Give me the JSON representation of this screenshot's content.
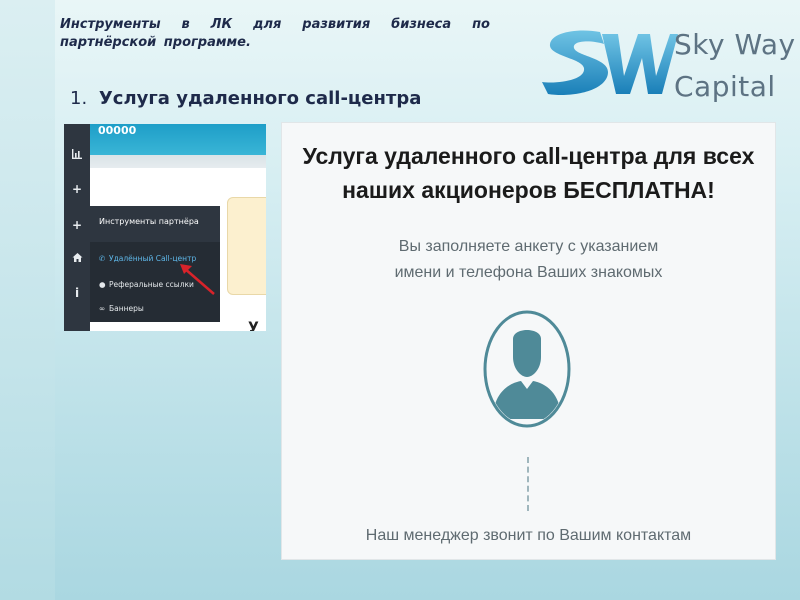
{
  "header": {
    "title": "Инструменты в ЛК для развития бизнеса по партнёрской программе."
  },
  "logo": {
    "mark": "SW",
    "line1": "Sky Way",
    "line2": "Capital"
  },
  "section": {
    "number": "1.",
    "title": "Услуга удаленного call-центра"
  },
  "screenshot_left": {
    "topbar_value": "00000",
    "sidebar_icons": [
      "bar-chart-icon",
      "plus-icon",
      "plus-icon",
      "home-icon",
      "info-icon"
    ],
    "menu_title": "Инструменты партнёра",
    "menu_items": [
      {
        "label": "Удалённый Call-центр",
        "icon": "phone-icon",
        "active": true
      },
      {
        "label": "Реферальные ссылки",
        "icon": "user-icon",
        "active": false
      },
      {
        "label": "Баннеры",
        "icon": "link-icon",
        "active": false
      }
    ],
    "stray_letter": "У",
    "arrow_color": "#d8232a"
  },
  "screenshot_right": {
    "title_line1": "Услуга удаленного call-центра для всех",
    "title_line2": "наших акционеров БЕСПЛАТНА!",
    "subtitle_line1": "Вы заполняете анкету с указанием",
    "subtitle_line2": "имени и телефона Ваших знакомых",
    "avatar_icon": "person-icon",
    "bottom_text": "Наш менеджер звонит по Вашим контактам",
    "accent_color": "#4f8a98"
  }
}
